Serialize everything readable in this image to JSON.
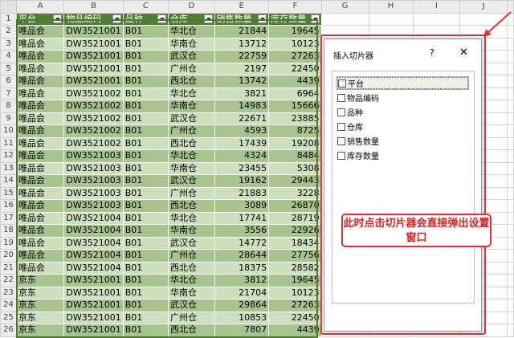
{
  "columns": [
    "A",
    "B",
    "C",
    "D",
    "E",
    "F",
    "G",
    "H",
    "I",
    "J"
  ],
  "table_headers": [
    "平台",
    "物品编码",
    "品种",
    "仓库",
    "销售数量",
    "库存数量"
  ],
  "rows": [
    {
      "n": "2",
      "platform": "唯品会",
      "code": "DW3521001",
      "variety": "B01",
      "warehouse": "华北仓",
      "sales": "21844",
      "stock": "19645"
    },
    {
      "n": "3",
      "platform": "唯品会",
      "code": "DW3521001",
      "variety": "B01",
      "warehouse": "华南仓",
      "sales": "13712",
      "stock": "10123"
    },
    {
      "n": "4",
      "platform": "唯品会",
      "code": "DW3521001",
      "variety": "B01",
      "warehouse": "武汉仓",
      "sales": "22759",
      "stock": "27263"
    },
    {
      "n": "5",
      "platform": "唯品会",
      "code": "DW3521001",
      "variety": "B01",
      "warehouse": "广州仓",
      "sales": "2197",
      "stock": "22450"
    },
    {
      "n": "6",
      "platform": "唯品会",
      "code": "DW3521001",
      "variety": "B01",
      "warehouse": "西北仓",
      "sales": "13742",
      "stock": "4439"
    },
    {
      "n": "7",
      "platform": "唯品会",
      "code": "DW3521002",
      "variety": "B01",
      "warehouse": "华北仓",
      "sales": "3821",
      "stock": "6964"
    },
    {
      "n": "8",
      "platform": "唯品会",
      "code": "DW3521002",
      "variety": "B01",
      "warehouse": "华南仓",
      "sales": "14983",
      "stock": "15666"
    },
    {
      "n": "9",
      "platform": "唯品会",
      "code": "DW3521002",
      "variety": "B01",
      "warehouse": "武汉仓",
      "sales": "22671",
      "stock": "23885"
    },
    {
      "n": "10",
      "platform": "唯品会",
      "code": "DW3521002",
      "variety": "B01",
      "warehouse": "广州仓",
      "sales": "4593",
      "stock": "8725"
    },
    {
      "n": "11",
      "platform": "唯品会",
      "code": "DW3521002",
      "variety": "B01",
      "warehouse": "西北仓",
      "sales": "17439",
      "stock": "19208"
    },
    {
      "n": "12",
      "platform": "唯品会",
      "code": "DW3521003",
      "variety": "B01",
      "warehouse": "华北仓",
      "sales": "4324",
      "stock": "8484"
    },
    {
      "n": "13",
      "platform": "唯品会",
      "code": "DW3521003",
      "variety": "B01",
      "warehouse": "华南仓",
      "sales": "23455",
      "stock": "5308"
    },
    {
      "n": "14",
      "platform": "唯品会",
      "code": "DW3521003",
      "variety": "B01",
      "warehouse": "武汉仓",
      "sales": "19162",
      "stock": "29443"
    },
    {
      "n": "15",
      "platform": "唯品会",
      "code": "DW3521003",
      "variety": "B01",
      "warehouse": "广州仓",
      "sales": "21883",
      "stock": "3228"
    },
    {
      "n": "16",
      "platform": "唯品会",
      "code": "DW3521003",
      "variety": "B01",
      "warehouse": "西北仓",
      "sales": "3089",
      "stock": "26870"
    },
    {
      "n": "17",
      "platform": "唯品会",
      "code": "DW3521004",
      "variety": "B01",
      "warehouse": "华北仓",
      "sales": "17741",
      "stock": "28719"
    },
    {
      "n": "18",
      "platform": "唯品会",
      "code": "DW3521004",
      "variety": "B01",
      "warehouse": "华南仓",
      "sales": "3556",
      "stock": "22926"
    },
    {
      "n": "19",
      "platform": "唯品会",
      "code": "DW3521004",
      "variety": "B01",
      "warehouse": "武汉仓",
      "sales": "14772",
      "stock": "18434"
    },
    {
      "n": "20",
      "platform": "唯品会",
      "code": "DW3521004",
      "variety": "B01",
      "warehouse": "广州仓",
      "sales": "28644",
      "stock": "27756"
    },
    {
      "n": "21",
      "platform": "唯品会",
      "code": "DW3521004",
      "variety": "B01",
      "warehouse": "西北仓",
      "sales": "18375",
      "stock": "28582"
    },
    {
      "n": "22",
      "platform": "京东",
      "code": "DW3521001",
      "variety": "B01",
      "warehouse": "华北仓",
      "sales": "3812",
      "stock": "19645"
    },
    {
      "n": "23",
      "platform": "京东",
      "code": "DW3521001",
      "variety": "B01",
      "warehouse": "华南仓",
      "sales": "21704",
      "stock": "10123"
    },
    {
      "n": "24",
      "platform": "京东",
      "code": "DW3521001",
      "variety": "B01",
      "warehouse": "武汉仓",
      "sales": "29864",
      "stock": "27263"
    },
    {
      "n": "25",
      "platform": "京东",
      "code": "DW3521001",
      "variety": "B01",
      "warehouse": "广州仓",
      "sales": "10853",
      "stock": "22450"
    },
    {
      "n": "26",
      "platform": "京东",
      "code": "DW3521001",
      "variety": "B01",
      "warehouse": "西北仓",
      "sales": "7807",
      "stock": "4439"
    }
  ],
  "dialog": {
    "title": "插入切片器",
    "help": "?",
    "close": "✕",
    "fields": [
      "平台",
      "物品编码",
      "品种",
      "仓库",
      "销售数量",
      "库存数量"
    ],
    "focused_index": 0
  },
  "annotation": "此时点击切片器会直接弹出设置窗口",
  "colors": {
    "header_fill": "#4f7f33",
    "band_dark": "#a8c48e",
    "band_light": "#cddfbd",
    "annotation_red": "#e53030"
  }
}
